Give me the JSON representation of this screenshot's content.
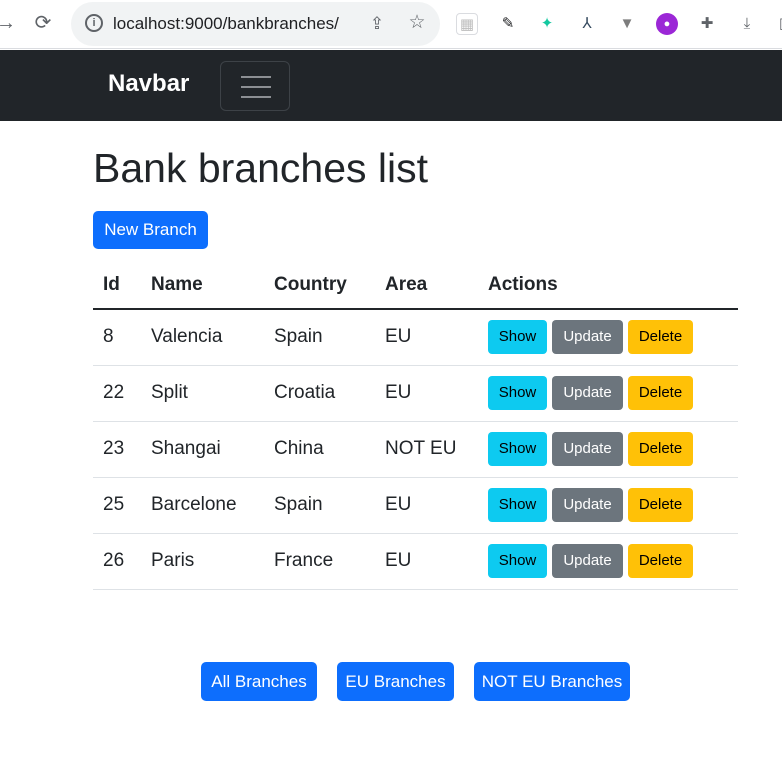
{
  "browser": {
    "url": "localhost:9000/bankbranches/",
    "extensions": [
      "extension-icon-1",
      "eyedropper-icon",
      "extension-icon-3",
      "extension-icon-4",
      "vue-devtools-icon",
      "extension-icon-6",
      "puzzle-icon",
      "download-icon"
    ]
  },
  "navbar": {
    "brand": "Navbar"
  },
  "page": {
    "title": "Bank branches list",
    "new_branch_label": "New Branch"
  },
  "table": {
    "headers": [
      "Id",
      "Name",
      "Country",
      "Area",
      "Actions"
    ],
    "rows": [
      {
        "id": "8",
        "name": "Valencia",
        "country": "Spain",
        "area": "EU"
      },
      {
        "id": "22",
        "name": "Split",
        "country": "Croatia",
        "area": "EU"
      },
      {
        "id": "23",
        "name": "Shangai",
        "country": "China",
        "area": "NOT EU"
      },
      {
        "id": "25",
        "name": "Barcelone",
        "country": "Spain",
        "area": "EU"
      },
      {
        "id": "26",
        "name": "Paris",
        "country": "France",
        "area": "EU"
      }
    ],
    "actions": {
      "show": "Show",
      "update": "Update",
      "delete": "Delete"
    }
  },
  "filters": {
    "all": "All Branches",
    "eu": "EU Branches",
    "not_eu": "NOT EU Branches"
  },
  "colors": {
    "primary": "#0d6efd",
    "info": "#0dcaf0",
    "secondary": "#6c757d",
    "warning": "#ffc107",
    "navbar": "#212529"
  }
}
